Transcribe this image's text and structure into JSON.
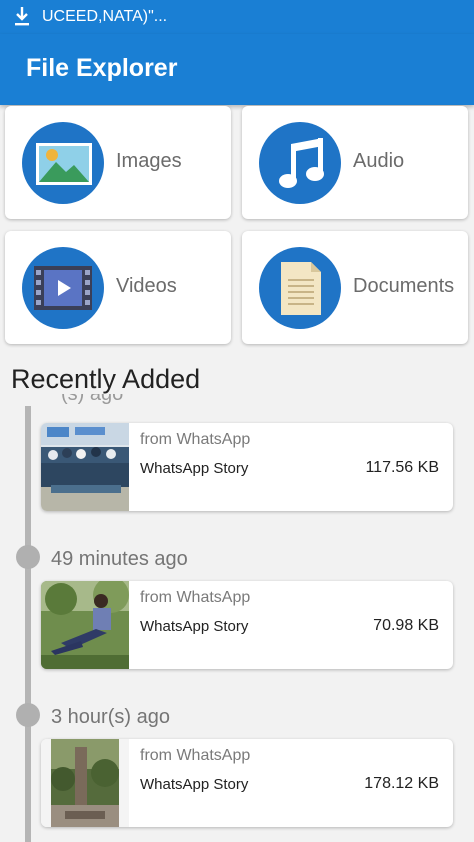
{
  "status_bar": {
    "notification_text": "UCEED,NATA)\"..."
  },
  "app_bar": {
    "title": "File Explorer"
  },
  "categories": [
    {
      "label": "Images",
      "icon": "image-icon"
    },
    {
      "label": "Audio",
      "icon": "music-note-icon"
    },
    {
      "label": "Videos",
      "icon": "video-film-icon"
    },
    {
      "label": "Documents",
      "icon": "document-icon"
    }
  ],
  "recent": {
    "title": "Recently Added",
    "partial_time": "(s) ago",
    "items": [
      {
        "time": "",
        "source": "from WhatsApp",
        "name": "WhatsApp Story",
        "size": "117.56 KB"
      },
      {
        "time": "49 minutes ago",
        "source": "from WhatsApp",
        "name": "WhatsApp Story",
        "size": "70.98 KB"
      },
      {
        "time": "3 hour(s) ago",
        "source": "from WhatsApp",
        "name": "WhatsApp Story",
        "size": "178.12 KB"
      }
    ]
  },
  "colors": {
    "primary": "#1a7fd4",
    "icon_circle": "#1f74c6",
    "timeline": "#b5b5b5"
  }
}
